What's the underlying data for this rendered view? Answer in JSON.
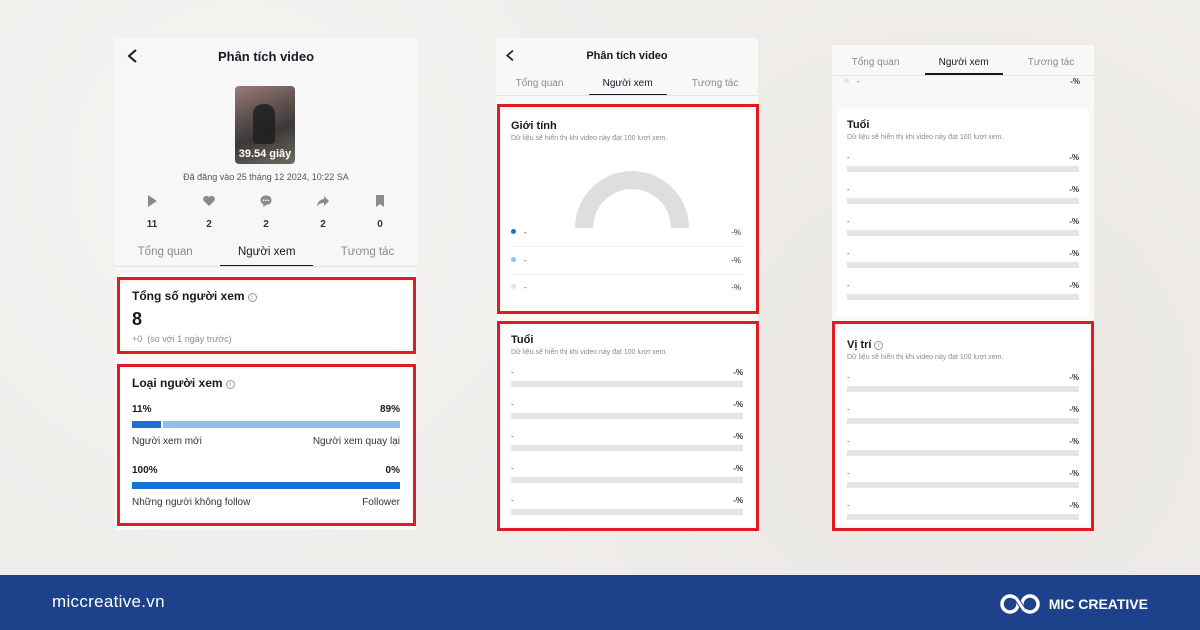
{
  "phone1": {
    "title": "Phân tích video",
    "duration": "39.54 giây",
    "posted": "Đã đăng vào 25 tháng 12 2024, 10:22 SA",
    "stats": [
      {
        "icon": "play-icon",
        "value": "11"
      },
      {
        "icon": "heart-icon",
        "value": "2"
      },
      {
        "icon": "comment-icon",
        "value": "2"
      },
      {
        "icon": "share-icon",
        "value": "2"
      },
      {
        "icon": "bookmark-icon",
        "value": "0"
      }
    ],
    "tabs": [
      "Tổng quan",
      "Người xem",
      "Tương tác"
    ],
    "active_tab": 1,
    "total_viewers": {
      "title": "Tổng số người xem",
      "value": "8",
      "change": "+0",
      "compare": "(so với 1 ngày trước)"
    },
    "viewer_types": {
      "title": "Loại người xem",
      "groups": [
        {
          "left_pct": "11%",
          "right_pct": "89%",
          "left_label": "Người xem mới",
          "right_label": "Người xem quay lại",
          "left_fraction": 0.11
        },
        {
          "left_pct": "100%",
          "right_pct": "0%",
          "left_label": "Những người không follow",
          "right_label": "Follower",
          "left_fraction": 1.0
        }
      ]
    }
  },
  "phone2": {
    "title": "Phân tích video",
    "tabs": [
      "Tổng quan",
      "Người xem",
      "Tương tác"
    ],
    "active_tab": 1,
    "gender": {
      "title": "Giới tính",
      "note": "Dữ liệu sẽ hiển thị khi video này đạt 100 lượt xem.",
      "rows": [
        {
          "label": "-",
          "value": "-%",
          "color": "#1b73d1"
        },
        {
          "label": "-",
          "value": "-%",
          "color": "#90bfea"
        },
        {
          "label": "-",
          "value": "-%",
          "color": "#e3e3e3"
        }
      ]
    },
    "age": {
      "title": "Tuổi",
      "note": "Dữ liệu sẽ hiển thị khi video này đạt 100 lượt xem.",
      "rows": [
        {
          "label": "-",
          "value": "-%"
        },
        {
          "label": "-",
          "value": "-%"
        },
        {
          "label": "-",
          "value": "-%"
        },
        {
          "label": "-",
          "value": "-%"
        },
        {
          "label": "-",
          "value": "-%"
        }
      ]
    }
  },
  "phone3": {
    "tabs": [
      "Tổng quan",
      "Người xem",
      "Tương tác"
    ],
    "active_tab": 1,
    "top_row": {
      "label": "-",
      "value": "-%"
    },
    "age": {
      "title": "Tuổi",
      "note": "Dữ liệu sẽ hiển thị khi video này đạt 100 lượt xem.",
      "rows": [
        {
          "label": "-",
          "value": "-%"
        },
        {
          "label": "-",
          "value": "-%"
        },
        {
          "label": "-",
          "value": "-%"
        },
        {
          "label": "-",
          "value": "-%"
        },
        {
          "label": "-",
          "value": "-%"
        }
      ]
    },
    "location": {
      "title": "Vị trí",
      "note": "Dữ liệu sẽ hiển thị khi video này đạt 100 lượt xem.",
      "rows": [
        {
          "label": "-",
          "value": "-%"
        },
        {
          "label": "-",
          "value": "-%"
        },
        {
          "label": "-",
          "value": "-%"
        },
        {
          "label": "-",
          "value": "-%"
        },
        {
          "label": "-",
          "value": "-%"
        }
      ]
    }
  },
  "footer": {
    "url": "miccreative.vn",
    "brand": "MIC CREATIVE"
  },
  "colors": {
    "highlight": "#e11b22",
    "footer_bg": "#1e418c",
    "bar_primary": "#1b73d1",
    "bar_secondary": "#90bfea"
  }
}
